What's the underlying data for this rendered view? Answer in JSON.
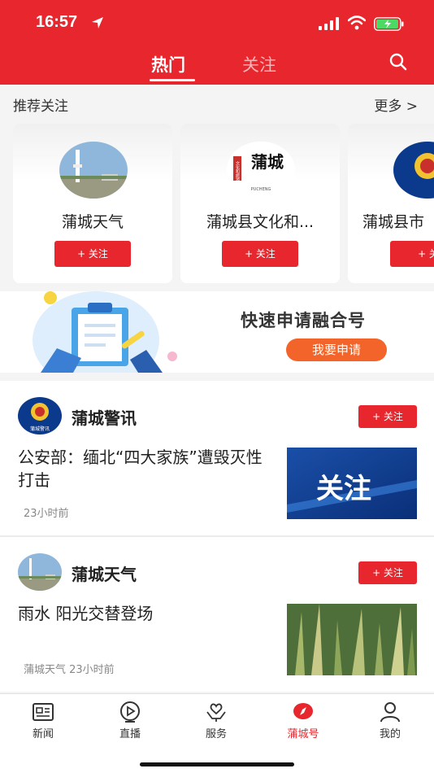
{
  "status": {
    "time": "16:57"
  },
  "tabs": {
    "hot": "热门",
    "follow": "关注"
  },
  "recommend": {
    "title": "推荐关注",
    "more": "更多 >",
    "cards": [
      {
        "name": "蒲城天气",
        "button": "+ 关注"
      },
      {
        "name": "蒲城县文化和...",
        "button": "+ 关注",
        "logo_text": "蒲城",
        "logo_side": "文化和旅游",
        "logo_sub": "PUCHENG"
      },
      {
        "name": "蒲城县市",
        "button": "+ 关"
      }
    ]
  },
  "banner": {
    "title": "快速申请融合号",
    "button": "我要申请"
  },
  "feed": [
    {
      "name": "蒲城警讯",
      "badge": "蒲城警讯",
      "button": "+ 关注",
      "text": "公安部：缅北“四大家族”遭毁灭性打击",
      "meta": "23小时前",
      "thumb_text": "关注"
    },
    {
      "name": "蒲城天气",
      "button": "+ 关注",
      "text": "雨水 阳光交替登场",
      "meta": "蒲城天气  23小时前"
    }
  ],
  "nav": [
    {
      "label": "新闻",
      "icon": "news-icon"
    },
    {
      "label": "直播",
      "icon": "live-icon"
    },
    {
      "label": "服务",
      "icon": "service-icon"
    },
    {
      "label": "蒲城号",
      "icon": "compass-icon"
    },
    {
      "label": "我的",
      "icon": "profile-icon"
    }
  ],
  "colors": {
    "brand": "#e8262d",
    "apply_button": "#f2642a"
  }
}
